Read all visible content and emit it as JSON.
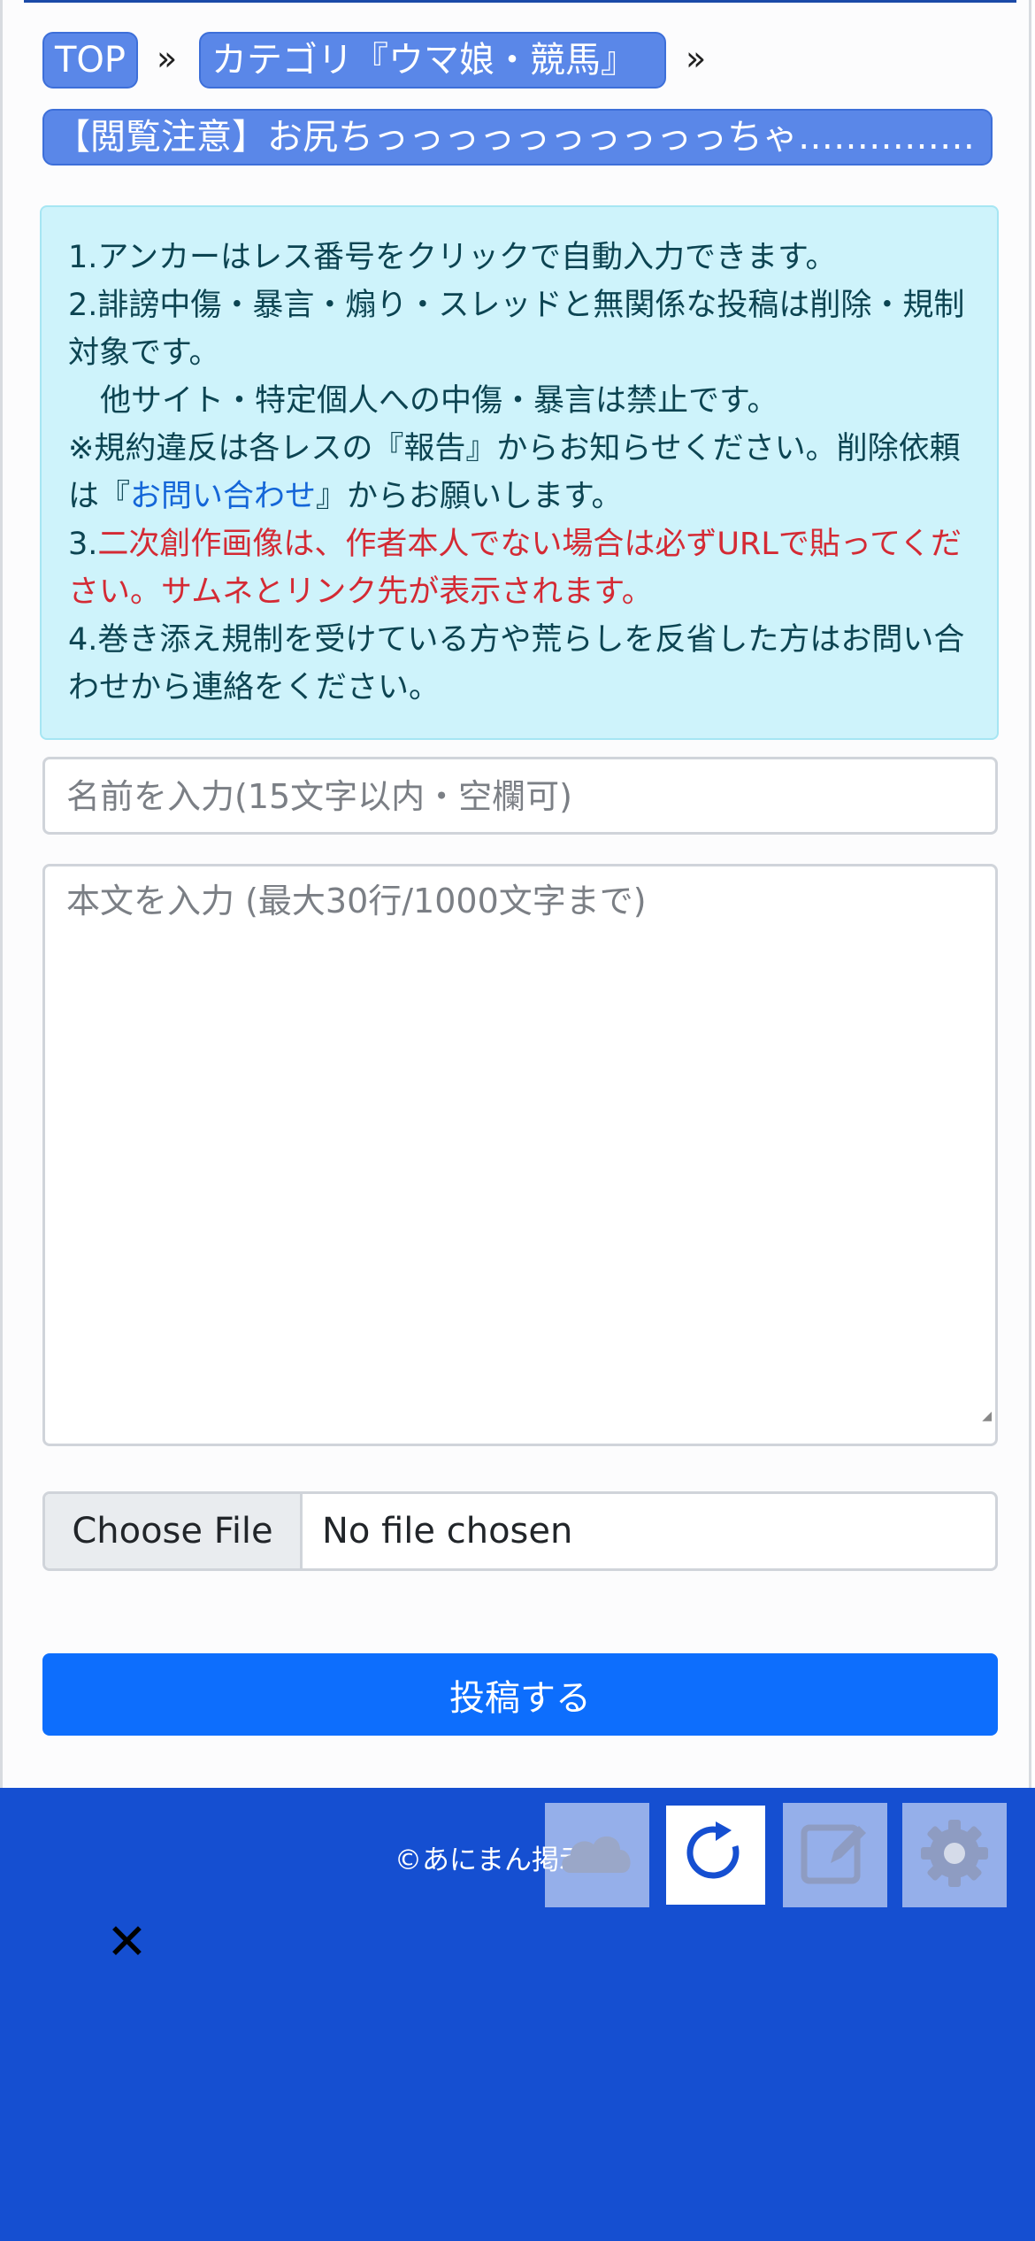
{
  "breadcrumb": {
    "top_label": "TOP",
    "separator": "»",
    "category_label": "カテゴリ『ウマ娘・競馬』",
    "thread_title": "【閲覧注意】お尻ちっっっっっっっっっっちゃ……………"
  },
  "notice": {
    "line1": "1.アンカーはレス番号をクリックで自動入力できます。",
    "line2": "2.誹謗中傷・暴言・煽り・スレッドと無関係な投稿は削除・規制対象です。",
    "line3": "他サイト・特定個人への中傷・暴言は禁止です。",
    "line4_pre": "※規約違反は各レスの『報告』からお知らせください。削除依頼は『",
    "line4_link": "お問い合わせ",
    "line4_post": "』からお願いします。",
    "line5_num": "3.",
    "line5_red": "二次創作画像は、作者本人でない場合は必ずURLで貼ってください。サムネとリンク先が表示されます。",
    "line6": "4.巻き添え規制を受けている方や荒らしを反省した方はお問い合わせから連絡をください。"
  },
  "form": {
    "name_placeholder": "名前を入力(15文字以内・空欄可)",
    "body_placeholder": "本文を入力 (最大30行/1000文字まで)",
    "file_button": "Choose File",
    "file_status": "No file chosen",
    "submit_label": "投稿する"
  },
  "footer": {
    "copyright": "©あにまん掲示板",
    "close_label": "✕",
    "colors": {
      "footer_bg": "#154fd1",
      "accent": "#0d6efd"
    },
    "icons": [
      "cloud-upload-icon",
      "refresh-icon",
      "edit-icon",
      "gear-icon"
    ]
  }
}
